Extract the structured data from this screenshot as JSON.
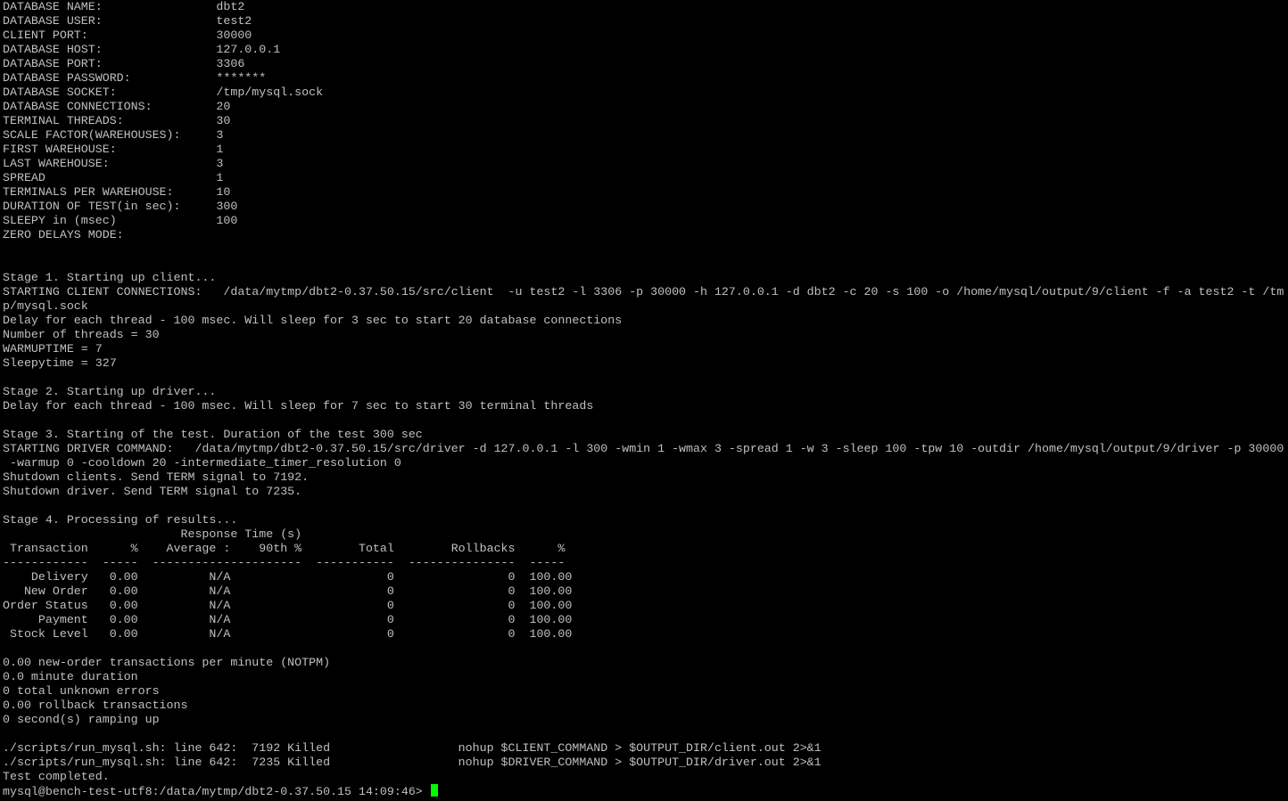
{
  "colors": {
    "background": "#000000",
    "foreground": "#c0c0c0",
    "cursor": "#00ff00"
  },
  "lines": [
    "DATABASE NAME:                dbt2",
    "DATABASE USER:                test2",
    "CLIENT PORT:                  30000",
    "DATABASE HOST:                127.0.0.1",
    "DATABASE PORT:                3306",
    "DATABASE PASSWORD:            *******",
    "DATABASE SOCKET:              /tmp/mysql.sock",
    "DATABASE CONNECTIONS:         20",
    "TERMINAL THREADS:             30",
    "SCALE FACTOR(WAREHOUSES):     3",
    "FIRST WAREHOUSE:              1",
    "LAST WAREHOUSE:               3",
    "SPREAD                        1",
    "TERMINALS PER WAREHOUSE:      10",
    "DURATION OF TEST(in sec):     300",
    "SLEEPY in (msec)              100",
    "ZERO DELAYS MODE:",
    "",
    "",
    "Stage 1. Starting up client...",
    "STARTING CLIENT CONNECTIONS:   /data/mytmp/dbt2-0.37.50.15/src/client  -u test2 -l 3306 -p 30000 -h 127.0.0.1 -d dbt2 -c 20 -s 100 -o /home/mysql/output/9/client -f -a test2 -t /tm",
    "p/mysql.sock",
    "Delay for each thread - 100 msec. Will sleep for 3 sec to start 20 database connections",
    "Number of threads = 30",
    "WARMUPTIME = 7",
    "Sleepytime = 327",
    "",
    "Stage 2. Starting up driver...",
    "Delay for each thread - 100 msec. Will sleep for 7 sec to start 30 terminal threads",
    "",
    "Stage 3. Starting of the test. Duration of the test 300 sec",
    "STARTING DRIVER COMMAND:   /data/mytmp/dbt2-0.37.50.15/src/driver -d 127.0.0.1 -l 300 -wmin 1 -wmax 3 -spread 1 -w 3 -sleep 100 -tpw 10 -outdir /home/mysql/output/9/driver -p 30000",
    " -warmup 0 -cooldown 20 -intermediate_timer_resolution 0",
    "Shutdown clients. Send TERM signal to 7192.",
    "Shutdown driver. Send TERM signal to 7235.",
    "",
    "Stage 4. Processing of results...",
    "                         Response Time (s)",
    " Transaction      %    Average :    90th %        Total        Rollbacks      %",
    "------------  -----  ---------------------  -----------  ---------------  -----",
    "    Delivery   0.00          N/A                      0                0  100.00",
    "   New Order   0.00          N/A                      0                0  100.00",
    "Order Status   0.00          N/A                      0                0  100.00",
    "     Payment   0.00          N/A                      0                0  100.00",
    " Stock Level   0.00          N/A                      0                0  100.00",
    "",
    "0.00 new-order transactions per minute (NOTPM)",
    "0.0 minute duration",
    "0 total unknown errors",
    "0.00 rollback transactions",
    "0 second(s) ramping up",
    "",
    "./scripts/run_mysql.sh: line 642:  7192 Killed                  nohup $CLIENT_COMMAND > $OUTPUT_DIR/client.out 2>&1",
    "./scripts/run_mysql.sh: line 642:  7235 Killed                  nohup $DRIVER_COMMAND > $OUTPUT_DIR/driver.out 2>&1",
    "Test completed."
  ],
  "prompt": "mysql@bench-test-utf8:/data/mytmp/dbt2-0.37.50.15 14:09:46> "
}
